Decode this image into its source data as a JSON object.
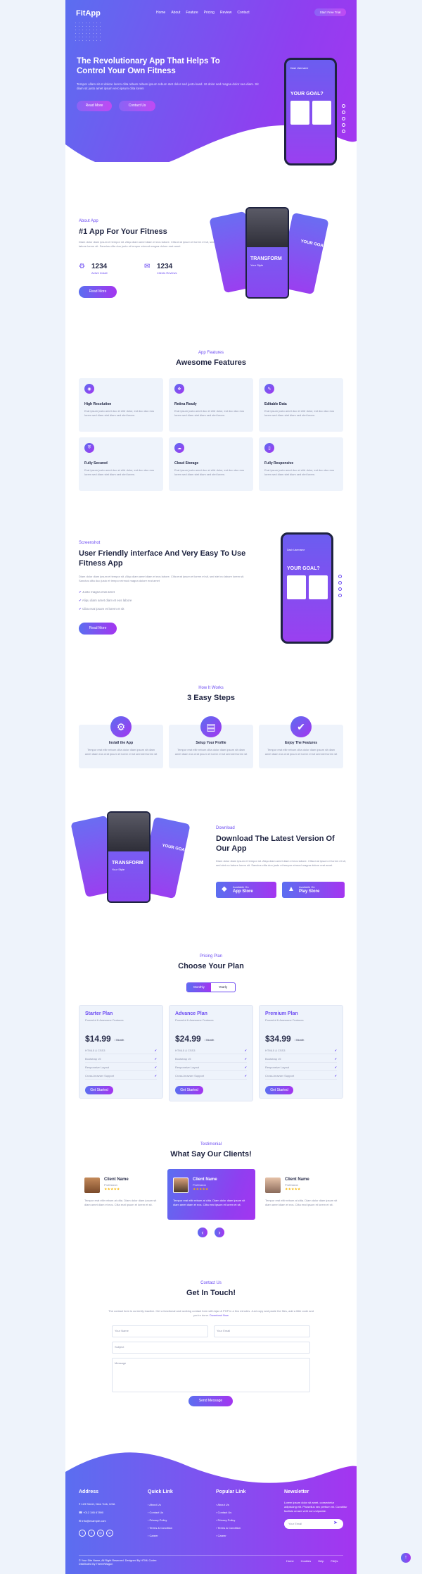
{
  "nav": {
    "logo": "FitApp",
    "links": [
      "Home",
      "About",
      "Feature",
      "Pricing",
      "Review",
      "Contact"
    ],
    "cta": "Start Free Trial"
  },
  "hero": {
    "title": "The Revolutionary App That Helps To Control Your Own Fitness",
    "desc": "Tempor ullam sit et dolore lorem clita rebum rebum ipsum rebum stet dolor sed justo kasd. Ut dolor sed magna dolor sea diam. Sit diam sit justo amet ipsum vero ipsum clita lorem",
    "btn1": "Read More",
    "btn2": "Contact Us",
    "phone_header": "Dash Username",
    "phone_text": "YOUR GOAL?"
  },
  "about": {
    "sub": "About App",
    "title": "#1 App For Your Fitness",
    "desc": "Diam dolor diam ipsum et tempor sit. Aliqu diam amet diam et eos labore. Clita erat ipsum et lorem et sit, sed stet no labore lorem sit. Sanctus clita duo justo et tempor eirmod magna dolore erat amet",
    "stat1_value": "1234",
    "stat1_label": "Active Install",
    "stat2_value": "1234",
    "stat2_label": "Clients Reviews",
    "btn": "Read More",
    "card_big": "TRANSFORM",
    "card_small": "YOUR GOAL?",
    "card_sub": "Your Style"
  },
  "features": {
    "sub": "App Features",
    "title": "Awesome Features",
    "items": [
      {
        "icon": "eye-icon",
        "title": "High Resolution",
        "desc": "Erat ipsum justo amet duo et elitr dolor, est duo duo eos lorem sed diam stet diam sed stet lorem."
      },
      {
        "icon": "layers-icon",
        "title": "Retina Ready",
        "desc": "Erat ipsum justo amet duo et elitr dolor, est duo duo eos lorem sed diam stet diam sed stet lorem."
      },
      {
        "icon": "edit-icon",
        "title": "Editable Data",
        "desc": "Erat ipsum justo amet duo et elitr dolor, est duo duo eos lorem sed diam stet diam sed stet lorem."
      },
      {
        "icon": "shield-icon",
        "title": "Fully Secured",
        "desc": "Erat ipsum justo amet duo et elitr dolor, est duo duo eos lorem sed diam stet diam sed stet lorem."
      },
      {
        "icon": "cloud-icon",
        "title": "Cloud Storage",
        "desc": "Erat ipsum justo amet duo et elitr dolor, est duo duo eos lorem sed diam stet diam sed stet lorem."
      },
      {
        "icon": "mobile-icon",
        "title": "Fully Responsive",
        "desc": "Erat ipsum justo amet duo et elitr dolor, est duo duo eos lorem sed diam stet diam sed stet lorem."
      }
    ]
  },
  "screenshot": {
    "sub": "Screenshot",
    "title": "User Friendly interface And Very Easy To Use Fitness App",
    "desc": "Diam dolor diam ipsum et tempor sit. Aliqu diam amet diam et eos labore. Clita erat ipsum et lorem et sit, sed stet no labore lorem sit. Sanctus clita duo justo et tempor eirmod magna dolore erat amet",
    "checks": [
      "Justo magna erat amet",
      "Aliqu diam amet diam et eos labore",
      "Clita erat ipsum et lorem et sit"
    ],
    "btn": "Read More"
  },
  "steps": {
    "sub": "How It Works",
    "title": "3 Easy Steps",
    "items": [
      {
        "icon": "gear-icon",
        "title": "Install the App",
        "desc": "Tempor erat elitr rebum clita dolor diam ipsum sit diam amet diam eos erat ipsum et lorem et sit sed stet lorem sit"
      },
      {
        "icon": "id-card-icon",
        "title": "Setup Your Profile",
        "desc": "Tempor erat elitr rebum clita dolor diam ipsum sit diam amet diam eos erat ipsum et lorem et sit sed stet lorem sit"
      },
      {
        "icon": "check-icon",
        "title": "Enjoy The Features",
        "desc": "Tempor erat elitr rebum clita dolor diam ipsum sit diam amet diam eos erat ipsum et lorem et sit sed stet lorem sit"
      }
    ]
  },
  "download": {
    "sub": "Download",
    "title": "Download The Latest Version Of Our App",
    "desc": "Diam dolor diam ipsum et tempor sit. Aliqu diam amet diam et eos labore. Clita erat ipsum et lorem et sit, sed stet no labore lorem sit. Sanctus clita duo justo et tempor eirmod magna dolore erat amet",
    "store1_small": "Available On",
    "store1": "App Store",
    "store2_small": "Available On",
    "store2": "Play Store"
  },
  "pricing": {
    "sub": "Pricing Plan",
    "title": "Choose Your Plan",
    "tab1": "Monthly",
    "tab2": "Yearly",
    "plans": [
      {
        "name": "Starter Plan",
        "sub": "Powerful & Awesome Features",
        "price": "$14.99",
        "per": "/ Month",
        "features": [
          "HTML5 & CSS3",
          "Bootstrap v5",
          "Responsive Layout",
          "Cross-browser Support"
        ],
        "btn": "Get Started"
      },
      {
        "name": "Advance Plan",
        "sub": "Powerful & Awesome Features",
        "price": "$24.99",
        "per": "/ Month",
        "features": [
          "HTML5 & CSS3",
          "Bootstrap v5",
          "Responsive Layout",
          "Cross-browser Support"
        ],
        "btn": "Get Started"
      },
      {
        "name": "Premium Plan",
        "sub": "Powerful & Awesome Features",
        "price": "$34.99",
        "per": "/ Month",
        "features": [
          "HTML5 & CSS3",
          "Bootstrap v5",
          "Responsive Layout",
          "Cross-browser Support"
        ],
        "btn": "Get Started"
      }
    ]
  },
  "testimonial": {
    "sub": "Testimonial",
    "title": "What Say Our Clients!",
    "items": [
      {
        "name": "Client Name",
        "role": "Profession",
        "stars": "★★★★★",
        "text": "Tempor erat elitr rebum at clita. Diam dolor diam ipsum sit diam amet diam et eos. Clita erat ipsum et lorem et sit."
      },
      {
        "name": "Client Name",
        "role": "Profession",
        "stars": "★★★★★",
        "text": "Tempor erat elitr rebum at clita. Diam dolor diam ipsum sit diam amet diam et eos. Clita erat ipsum et lorem et sit."
      },
      {
        "name": "Client Name",
        "role": "Profession",
        "stars": "★★★★★",
        "text": "Tempor erat elitr rebum at clita. Diam dolor diam ipsum sit diam amet diam et eos. Clita erat ipsum et lorem et sit."
      }
    ],
    "prev": "‹",
    "next": "›"
  },
  "contact": {
    "sub": "Contact Us",
    "title": "Get In Touch!",
    "desc": "The contact form is currently inactive. Get a functional and working contact form with Ajax & PHP in a few minutes. Just copy and paste the files, add a little code and you're done.",
    "link": "Download Now",
    "name_ph": "Your Name",
    "email_ph": "Your Email",
    "subject_ph": "Subject",
    "message_ph": "Message",
    "btn": "Send Message"
  },
  "footer": {
    "address_h": "Address",
    "address": [
      "123 Street, New York, USA",
      "+012 345 67890",
      "info@example.com"
    ],
    "quick_h": "Quick Link",
    "quick": [
      "About Us",
      "Contact Us",
      "Privacy Policy",
      "Terms & Condition",
      "Career"
    ],
    "popular_h": "Popular Link",
    "popular": [
      "About Us",
      "Contact Us",
      "Privacy Policy",
      "Terms & Condition",
      "Career"
    ],
    "news_h": "Newsletter",
    "news_desc": "Lorem ipsum dolor sit amet, consectetur adipiscing elit. Phasellus nec pretium mi. Curabitur facilisis ornare velit non vulputate.",
    "news_ph": "Your Email",
    "copyright": "© Your Site Name, All Right Reserved. Designed By HTML Codex",
    "distributed": "Distributed By ThemeWagon",
    "links": [
      "Home",
      "Cookies",
      "Help",
      "FAQs"
    ]
  },
  "colors": {
    "primary": "#5b6ef0",
    "secondary": "#a435f0",
    "light": "#eef3fb",
    "dark": "#1e2340"
  }
}
